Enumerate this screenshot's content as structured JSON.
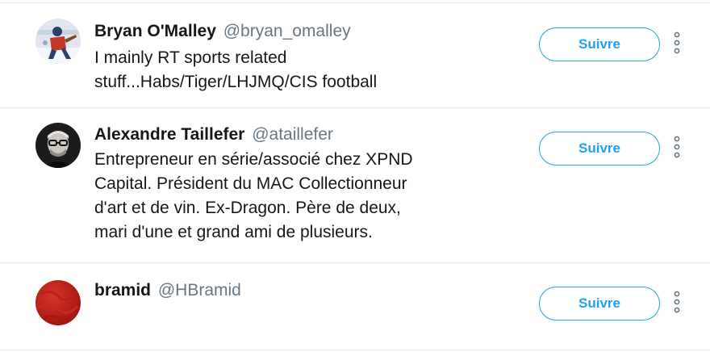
{
  "users": [
    {
      "display_name": "Bryan O'Malley",
      "handle": "@bryan_omalley",
      "bio_lines": [
        "I mainly RT sports related",
        "stuff...Habs/Tiger/LHJMQ/CIS football"
      ],
      "follow_label": "Suivre",
      "more_icon": "more-vertical-icon"
    },
    {
      "display_name": "Alexandre Taillefer",
      "handle": "@ataillefer",
      "bio_lines": [
        "Entrepreneur en série/associé chez XPND",
        "Capital. Président du MAC Collectionneur",
        "d'art et de vin. Ex-Dragon. Père de deux,",
        "mari d'une et grand ami de plusieurs."
      ],
      "follow_label": "Suivre",
      "more_icon": "more-vertical-icon"
    },
    {
      "display_name": "bramid",
      "handle": "@HBramid",
      "bio_lines": [],
      "follow_label": "Suivre",
      "more_icon": "more-vertical-icon"
    }
  ],
  "colors": {
    "accent": "#1da1f2",
    "handle": "#657786",
    "text": "#14171a",
    "divider": "#e6ecf0"
  }
}
